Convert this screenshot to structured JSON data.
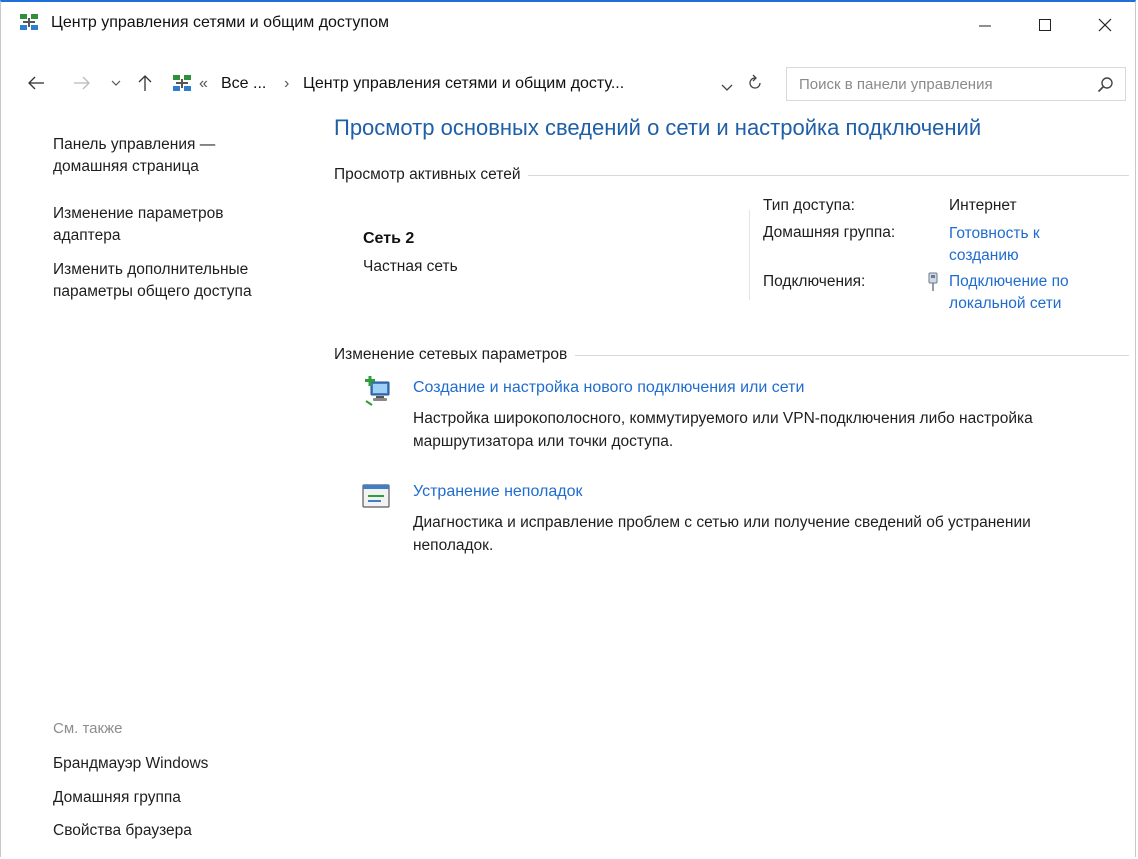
{
  "window": {
    "title": "Центр управления сетями и общим доступом"
  },
  "addressbar": {
    "overflow": "«",
    "crumb_1": "Все ...",
    "separator": "›",
    "crumb_2": "Центр управления сетями и общим досту...",
    "search_placeholder": "Поиск в панели управления"
  },
  "sidebar": {
    "home_line1": "Панель управления —",
    "home_line2": "домашняя страница",
    "adapter_line1": "Изменение параметров",
    "adapter_line2": "адаптера",
    "sharing_line1": "Изменить дополнительные",
    "sharing_line2": "параметры общего доступа",
    "see_also": "См. также",
    "see_also_items": [
      "Брандмауэр Windows",
      "Домашняя группа",
      "Свойства браузера"
    ]
  },
  "main": {
    "title": "Просмотр основных сведений о сети и настройка подключений",
    "active_networks_header": "Просмотр активных сетей",
    "network": {
      "name": "Сеть 2",
      "type": "Частная сеть",
      "access_type_label": "Тип доступа:",
      "access_type_value": "Интернет",
      "homegroup_label": "Домашняя группа:",
      "homegroup_line1": "Готовность к",
      "homegroup_line2": "созданию",
      "connections_label": "Подключения:",
      "connection_line1": "Подключение по",
      "connection_line2": "локальной сети"
    },
    "change_settings_header": "Изменение сетевых параметров",
    "tasks": [
      {
        "title": "Создание и настройка нового подключения или сети",
        "desc_line1": "Настройка широкополосного, коммутируемого или VPN-подключения либо настройка",
        "desc_line2": "маршрутизатора или точки доступа."
      },
      {
        "title": "Устранение неполадок",
        "desc_line1": "Диагностика и исправление проблем с сетью или получение сведений об устранении",
        "desc_line2": "неполадок."
      }
    ]
  },
  "colors": {
    "link": "#1f6ccf",
    "title": "#1e5fa8",
    "accent_border": "#1e6fd9"
  }
}
